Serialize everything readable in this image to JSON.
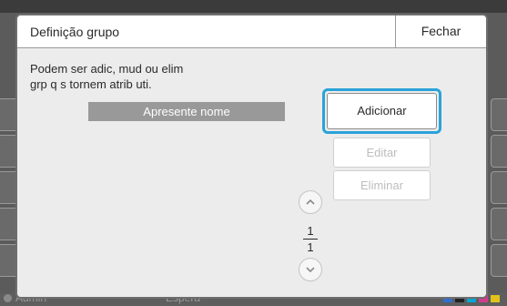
{
  "dialog": {
    "title": "Definição grupo",
    "close_label": "Fechar",
    "description_line1": "Podem ser adic, mud ou elim",
    "description_line2": "grp q s tornem atrib uti.",
    "name_placeholder": "Apresente nome",
    "buttons": {
      "add": "Adicionar",
      "edit": "Editar",
      "delete": "Eliminar"
    },
    "pagination": {
      "current": "1",
      "total": "1"
    }
  },
  "status_bar": {
    "user": "Admin",
    "state": "Espera",
    "ink_colors": [
      "#2f6fd0",
      "#222222",
      "#00a6d6",
      "#d23c8c",
      "#e2c21a"
    ]
  },
  "colors": {
    "focus_ring": "#2aa3d8",
    "name_field_bg": "#999999",
    "disabled_text": "#bdbdbd"
  },
  "icons": {
    "scroll_up": "chevron-up-icon",
    "scroll_down": "chevron-down-icon"
  }
}
